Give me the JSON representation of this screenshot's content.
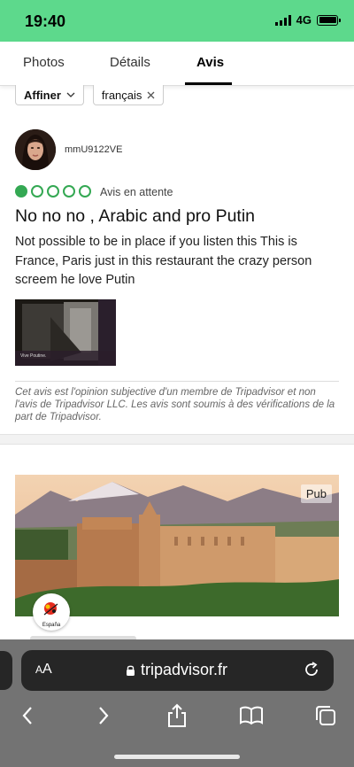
{
  "status_bar": {
    "time": "19:40",
    "network": "4G"
  },
  "tabs": [
    {
      "label": "Photos"
    },
    {
      "label": "Détails"
    },
    {
      "label": "Avis"
    }
  ],
  "filters": {
    "refine_label": "Affiner",
    "language_chip": "français"
  },
  "review": {
    "username": "mmU9122VE",
    "rating": 1,
    "rating_max": 5,
    "status": "Avis en attente",
    "title": "No no no , Arabic and pro Putin",
    "body": "Not possible to be in place if you listen this This is France, Paris just in this restaurant the crazy person screem he love Putin",
    "photo_caption": "Vive Poutine."
  },
  "disclaimer": "Cet avis est l'opinion subjective d'un membre de Tripadvisor et non l'avis de Tripadvisor LLC. Les avis sont soumis à des vérifications de la part de Tripadvisor.",
  "ad": {
    "badge": "Pub",
    "logo_text": "España"
  },
  "browser": {
    "aa_label": "AA",
    "url": "tripadvisor.fr"
  },
  "colors": {
    "status_bar_bg": "#5dd98c",
    "bubble": "#34a853",
    "browser_bg": "#737373",
    "url_bar_bg": "#262626"
  }
}
